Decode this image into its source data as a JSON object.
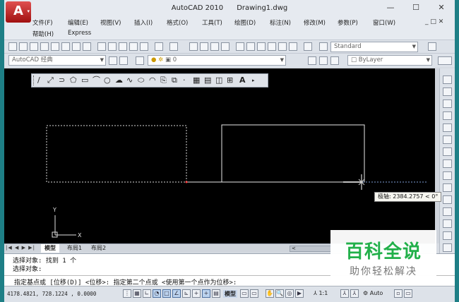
{
  "window": {
    "title_app": "AutoCAD 2010",
    "title_doc": "Drawing1.dwg",
    "minimize": "—",
    "maximize": "☐",
    "close": "✕"
  },
  "menu": {
    "row1": [
      "文件(F)",
      "编辑(E)",
      "视图(V)",
      "插入(I)",
      "格式(O)",
      "工具(T)",
      "绘图(D)",
      "标注(N)",
      "修改(M)",
      "参数(P)",
      "窗口(W)"
    ],
    "row2": [
      "帮助(H)",
      "Express"
    ],
    "mdi_controls": "_ □ ✕"
  },
  "toolbar": {
    "text_style": "Standard",
    "workspace": "AutoCAD 经典",
    "layer": "0",
    "color": "ByLayer"
  },
  "drawing": {
    "ucs_y": "Y",
    "ucs_x": "X",
    "polar_tooltip": "极轴: 2384.2757 < 0°",
    "background": "#000000",
    "line_color": "#ffffff"
  },
  "tabs": {
    "nav": "|◀ ◀ ▶ ▶|",
    "items": [
      "模型",
      "布局1",
      "布局2"
    ],
    "scroll_arrow": "<"
  },
  "command": {
    "history": [
      "选择对象: 找到 1 个",
      "选择对象:"
    ],
    "prompt": "指定基点或 [位移(D)] <位移>:  指定第二个点或 <使用第一个点作为位移>:"
  },
  "status": {
    "coordinates": "4178.4821, 728.1224 , 0.0000",
    "model_label": "模型",
    "scale": "1:1",
    "workspace_mode": "Auto"
  },
  "watermark": {
    "title": "百科全说",
    "subtitle": "助你轻松解决"
  }
}
